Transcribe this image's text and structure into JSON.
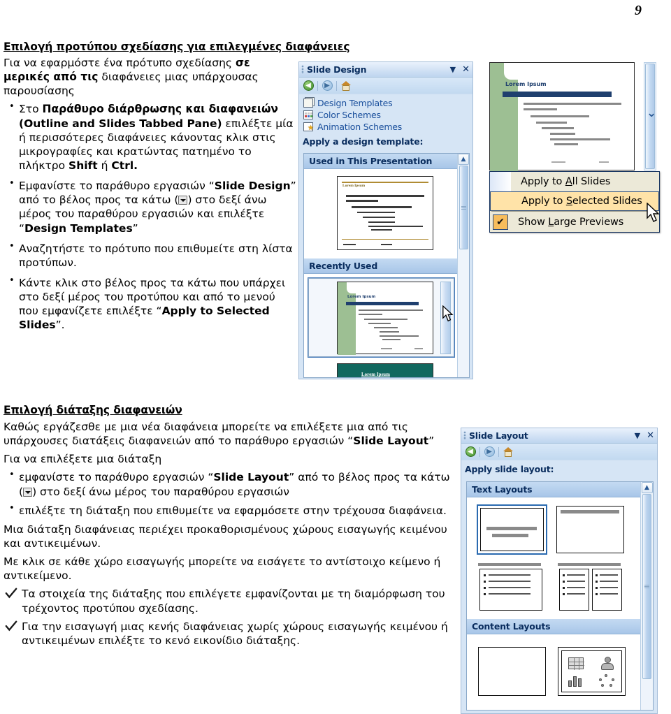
{
  "page": {
    "number": "9"
  },
  "top_section": {
    "title": "Επιλογή προτύπου σχεδίασης για επιλεγμένες διαφάνειες",
    "intro_line1_a": "Για να εφαρμόστε ένα πρότυπο σχεδίασης ",
    "intro_line1_b": "σε",
    "intro_line2_b": "μερικές από τις",
    "intro_line2_a": " διαφάνειες μιας υπάρχουσας",
    "intro_line3": "παρουσίασης",
    "bullets": [
      {
        "parts": [
          {
            "t": "Στο ",
            "b": false
          },
          {
            "t": "Παράθυρο διάρθρωσης και διαφανειών (Outline and Slides Tabbed Pane)",
            "b": true
          },
          {
            "t": " επιλέξτε μία ή περισσότερες διαφάνειες κάνοντας κλικ στις μικρογραφίες και κρατώντας πατημένο το πλήκτρο ",
            "b": false
          },
          {
            "t": "Shift",
            "b": true
          },
          {
            "t": " ή ",
            "b": false
          },
          {
            "t": "Ctrl.",
            "b": true
          }
        ]
      },
      {
        "parts": [
          {
            "t": "Εμφανίστε το παράθυρο εργασιών “",
            "b": false
          },
          {
            "t": "Slide Design",
            "b": true
          },
          {
            "t": "” από το βέλος προς τα κάτω (",
            "b": false
          },
          {
            "t": "ARROWBOX",
            "b": false
          },
          {
            "t": ") στο δεξί άνω μέρος του παραθύρου εργασιών και επιλέξτε “",
            "b": false
          },
          {
            "t": "Design Templates",
            "b": true
          },
          {
            "t": "”",
            "b": false
          }
        ]
      },
      {
        "parts": [
          {
            "t": "Αναζητήστε το πρότυπο που επιθυμείτε στη λίστα προτύπων.",
            "b": false
          }
        ]
      },
      {
        "parts": [
          {
            "t": "Κάντε κλικ στο βέλος προς τα κάτω που υπάρχει στο δεξί μέρος του προτύπου και από το μενού που εμφανίζετε επιλέξτε “",
            "b": false
          },
          {
            "t": "Apply to Selected Slides",
            "b": true
          },
          {
            "t": "”.",
            "b": false
          }
        ]
      }
    ]
  },
  "bottom_section": {
    "title": "Επιλογή διάταξης διαφανειών",
    "para1_parts": [
      {
        "t": "Καθώς εργάζεσθε με μια νέα διαφάνεια μπορείτε να επιλέξετε μια από τις υπάρχουσες διατάξεις διαφανειών από το παράθυρο εργασιών “",
        "b": false
      },
      {
        "t": "Slide Layout",
        "b": true
      },
      {
        "t": "”",
        "b": false
      }
    ],
    "para2": "Για να επιλέξετε μια διάταξη",
    "bullets": [
      {
        "parts": [
          {
            "t": "εμφανίστε το παράθυρο εργασιών “",
            "b": false
          },
          {
            "t": "Slide Layout",
            "b": true
          },
          {
            "t": "” από το βέλος προς τα κάτω (",
            "b": false
          },
          {
            "t": "ARROWBOX",
            "b": false
          },
          {
            "t": ") στο δεξί άνω μέρος του παραθύρου εργασιών",
            "b": false
          }
        ]
      },
      {
        "parts": [
          {
            "t": "επιλέξτε τη διάταξη που επιθυμείτε να εφαρμόσετε στην τρέχουσα διαφάνεια.",
            "b": false
          }
        ]
      }
    ],
    "para3": "Μια διάταξη διαφάνειας περιέχει προκαθορισμένους χώρους εισαγωγής κειμένου και αντικειμένων.",
    "para4": "Με κλικ σε κάθε χώρο εισαγωγής μπορείτε να εισάγετε το αντίστοιχο κείμενο ή αντικείμενο.",
    "check1": "Τα στοιχεία της διάταξης που επιλέγετε εμφανίζονται με τη διαμόρφωση του τρέχοντος προτύπου σχεδίασης.",
    "check2": "Για την εισαγωγή μιας κενής διαφάνειας χωρίς χώρους εισαγωγής κειμένου ή αντικειμένων επιλέξτε το κενό εικονίδιο διάταξης."
  },
  "slide_design_pane": {
    "title": "Slide Design",
    "caret": "▼",
    "close": "✕",
    "nav": {
      "back": "back-icon",
      "forward": "forward-icon",
      "home": "home-icon"
    },
    "links": [
      {
        "label": "Design Templates",
        "icon": "design-templates-icon"
      },
      {
        "label": "Color Schemes",
        "icon": "color-schemes-icon"
      },
      {
        "label": "Animation Schemes",
        "icon": "animation-schemes-icon"
      }
    ],
    "heading": "Apply a design template:",
    "groups": [
      {
        "label": "Used in This Presentation"
      },
      {
        "label": "Recently Used"
      }
    ],
    "thumb_title": "Lorem Ipsum"
  },
  "context_menu": {
    "items": [
      {
        "label_pre": "Apply to ",
        "accel": "A",
        "label_post": "ll Slides",
        "highlighted": false,
        "checked": false
      },
      {
        "label_pre": "Apply to ",
        "accel": "S",
        "label_post": "elected Slides",
        "highlighted": true,
        "checked": false
      },
      {
        "label_pre": "Show ",
        "accel": "L",
        "label_post": "arge Previews",
        "highlighted": false,
        "checked": true
      }
    ],
    "check_glyph": "✔"
  },
  "preview_slide": {
    "title": "Lorem Ipsum"
  },
  "slide_layout_pane": {
    "title": "Slide Layout",
    "caret": "▼",
    "close": "✕",
    "heading": "Apply slide layout:",
    "groups": [
      {
        "label": "Text Layouts"
      },
      {
        "label": "Content Layouts"
      }
    ]
  },
  "colors": {
    "pane_bg": "#d6e5f5",
    "pane_title_text": "#0a2d5e",
    "link_text": "#1a4f9c",
    "group_header": "#a8c6e8",
    "menu_bg": "#ece9d8",
    "menu_highlight": "#ffe3a8",
    "menu_border": "#16335f",
    "check_bg": "#f7bd5c"
  }
}
